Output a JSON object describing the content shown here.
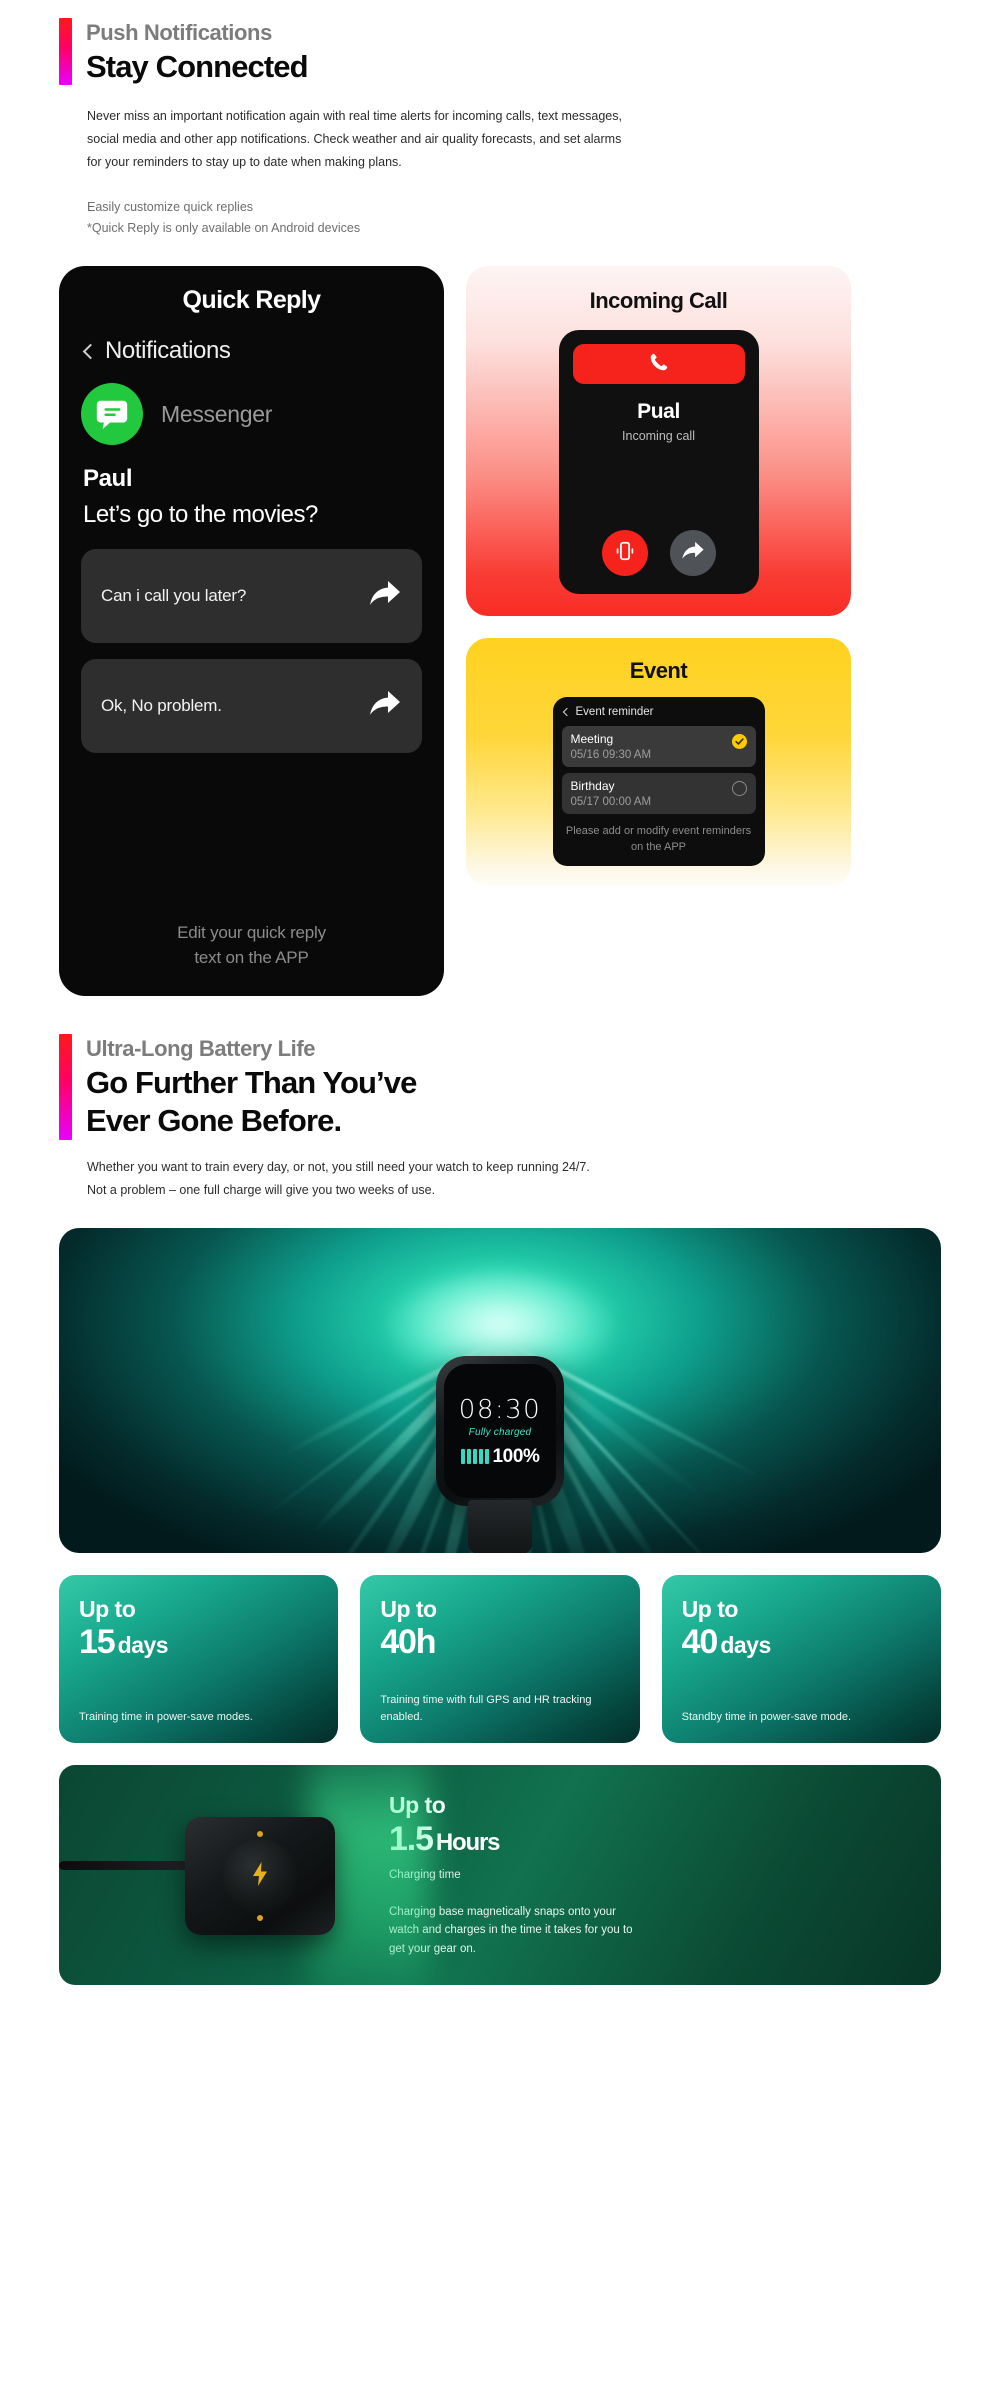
{
  "push_section": {
    "eyebrow": "Push Notifications",
    "headline": "Stay Connected",
    "body": "Never miss an important notification again with real time alerts for incoming calls, text messages, social media and other app notifications. Check weather and air quality forecasts, and set alarms for your reminders to stay up to date when making plans.",
    "sub_line_1": "Easily customize quick replies",
    "sub_line_2": "*Quick Reply is only available on Android devices"
  },
  "quick_reply_card": {
    "title": "Quick Reply",
    "nav_label": "Notifications",
    "app_name": "Messenger",
    "sender": "Paul",
    "message": "Let’s go to the movies?",
    "replies": [
      {
        "text": "Can i call you later?"
      },
      {
        "text": "Ok, No problem."
      }
    ],
    "footer_line_1": "Edit your quick reply",
    "footer_line_2": "text on the APP"
  },
  "incoming_call_card": {
    "title": "Incoming Call",
    "caller_name": "Pual",
    "status": "Incoming call",
    "accept_icon": "phone-icon",
    "decline_icon": "vibrate-icon",
    "reply_icon": "reply-arrow-icon"
  },
  "event_card": {
    "title": "Event",
    "nav_label": "Event reminder",
    "items": [
      {
        "name": "Meeting",
        "time": "05/16 09:30 AM",
        "state": "checked"
      },
      {
        "name": "Birthday",
        "time": "05/17 00:00 AM",
        "state": "unchecked"
      }
    ],
    "footer": "Please add or modify event reminders on the APP"
  },
  "battery_section": {
    "eyebrow": "Ultra-Long Battery Life",
    "headline_line_1": "Go Further Than You’ve",
    "headline_line_2": "Ever Gone Before.",
    "body_line_1": "Whether you want to train every day, or not, you still need your watch to keep running 24/7.",
    "body_line_2": "Not a problem – one full charge will give you two weeks of use."
  },
  "hero_watch": {
    "time": "08:30",
    "status": "Fully charged",
    "percent": "100%",
    "bars": 5
  },
  "stats": [
    {
      "upto": "Up to",
      "number": "15",
      "unit": "days",
      "description": "Training time in power-save modes."
    },
    {
      "upto": "Up to",
      "number": "40h",
      "unit": "",
      "description": "Training time with full GPS and HR tracking enabled."
    },
    {
      "upto": "Up to",
      "number": "40",
      "unit": "days",
      "description": "Standby time in power-save mode."
    }
  ],
  "charging": {
    "upto": "Up to",
    "number": "1.5",
    "unit": "Hours",
    "label": "Charging time",
    "description": "Charging base magnetically snaps onto your watch and charges in the time it takes for you to get your gear on."
  },
  "colors": {
    "accent_top": "#ff1a1a",
    "accent_bottom": "#e800ff",
    "messenger_green": "#22c93f",
    "call_red": "#f5231b",
    "event_yellow": "#ffd21f",
    "teal": "#18a98d"
  }
}
